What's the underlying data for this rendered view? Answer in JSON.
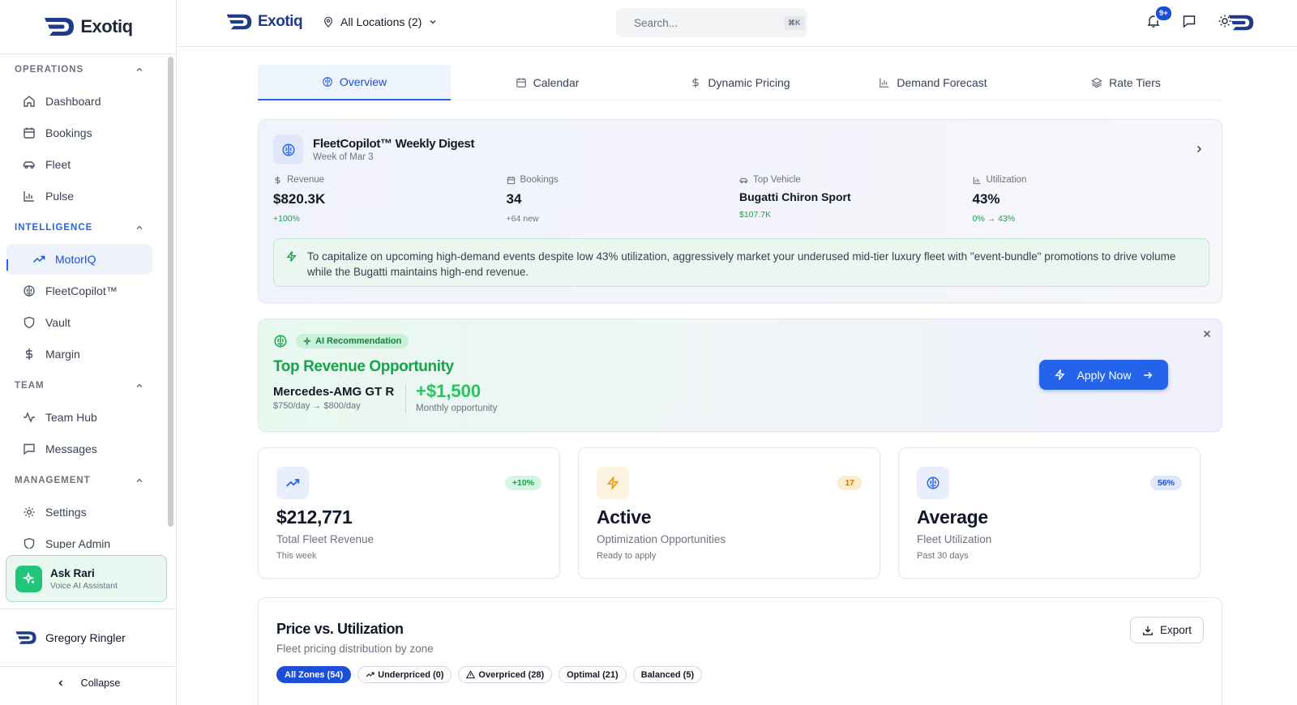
{
  "brand": {
    "name": "Exotiq"
  },
  "sidebar": {
    "sections": [
      {
        "label": "OPERATIONS",
        "items": [
          {
            "label": "Dashboard"
          },
          {
            "label": "Bookings"
          },
          {
            "label": "Fleet"
          },
          {
            "label": "Pulse"
          }
        ]
      },
      {
        "label": "INTELLIGENCE",
        "items": [
          {
            "label": "MotorIQ"
          },
          {
            "label": "FleetCopilot™"
          },
          {
            "label": "Vault"
          },
          {
            "label": "Margin"
          }
        ]
      },
      {
        "label": "TEAM",
        "items": [
          {
            "label": "Team Hub"
          },
          {
            "label": "Messages"
          }
        ]
      },
      {
        "label": "MANAGEMENT",
        "items": [
          {
            "label": "Settings"
          },
          {
            "label": "Super Admin"
          }
        ]
      }
    ],
    "assistant": {
      "title": "Ask Rari",
      "subtitle": "Voice AI Assistant"
    },
    "user": {
      "name": "Gregory Ringler"
    },
    "collapse_label": "Collapse"
  },
  "topbar": {
    "location": "All Locations (2)",
    "search_placeholder": "Search...",
    "search_shortcut": "⌘K",
    "notification_count": "9+"
  },
  "tabs": [
    {
      "label": "Overview"
    },
    {
      "label": "Calendar"
    },
    {
      "label": "Dynamic Pricing"
    },
    {
      "label": "Demand Forecast"
    },
    {
      "label": "Rate Tiers"
    }
  ],
  "digest": {
    "title": "FleetCopilot™ Weekly Digest",
    "subtitle": "Week of Mar 3",
    "stats": [
      {
        "label": "Revenue",
        "value": "$820.3K",
        "note": "+100%"
      },
      {
        "label": "Bookings",
        "value": "34",
        "note": "+64 new"
      },
      {
        "label": "Top Vehicle",
        "value": "Bugatti Chiron Sport",
        "note": "$107.7K"
      },
      {
        "label": "Utilization",
        "value": "43%",
        "note": "0% → 43%"
      }
    ],
    "insight": "To capitalize on upcoming high-demand events despite low 43% utilization, aggressively market your underused mid-tier luxury fleet with \"event-bundle\" promotions to drive volume while the Bugatti maintains high-end revenue."
  },
  "recommendation": {
    "badge": "AI Recommendation",
    "title": "Top Revenue Opportunity",
    "vehicle": "Mercedes-AMG GT R",
    "price_change": "$750/day → $800/day",
    "amount": "+$1,500",
    "amount_label": "Monthly opportunity",
    "button_label": "Apply Now"
  },
  "kpis": [
    {
      "badge": "+10%",
      "value": "$212,771",
      "label": "Total Fleet Revenue",
      "sub": "This week"
    },
    {
      "badge": "17",
      "value": "Active",
      "label": "Optimization Opportunities",
      "sub": "Ready to apply"
    },
    {
      "badge": "56%",
      "value": "Average",
      "label": "Fleet Utilization",
      "sub": "Past 30 days"
    }
  ],
  "price_utilization": {
    "title": "Price vs. Utilization",
    "subtitle": "Fleet pricing distribution by zone",
    "export_label": "Export",
    "filters": [
      {
        "label": "All Zones (54)"
      },
      {
        "label": "Underpriced (0)"
      },
      {
        "label": "Overpriced (28)"
      },
      {
        "label": "Optimal (21)"
      },
      {
        "label": "Balanced (5)"
      }
    ]
  },
  "colors": {
    "accent": "#2563eb",
    "success": "#22c55e",
    "warning": "#f59e0b"
  }
}
